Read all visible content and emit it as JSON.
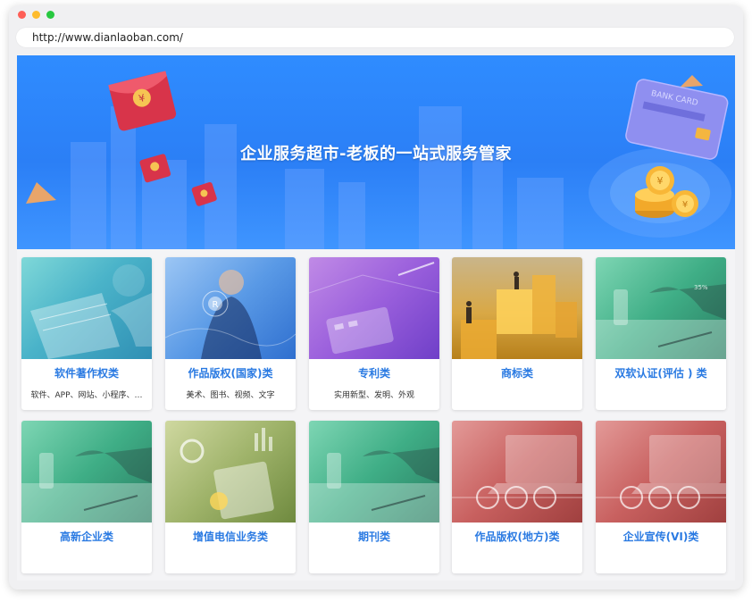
{
  "browser": {
    "url": "http://www.dianlaoban.com/"
  },
  "banner": {
    "title": "企业服务超市-老板的一站式服务管家",
    "card_text": "BANK CARD"
  },
  "cards": [
    {
      "title": "软件著作权类",
      "subtitle": "软件、APP、网站、小程序、…",
      "theme": "teal"
    },
    {
      "title": "作品版权(国家)类",
      "subtitle": "美术、图书、视频、文字",
      "theme": "blue"
    },
    {
      "title": "专利类",
      "subtitle": "实用新型、发明、外观",
      "theme": "purple"
    },
    {
      "title": "商标类",
      "subtitle": "",
      "theme": "gold"
    },
    {
      "title": "双软认证(评估 ) 类",
      "subtitle": "",
      "theme": "green"
    },
    {
      "title": "高新企业类",
      "subtitle": "",
      "theme": "green"
    },
    {
      "title": "增值电信业务类",
      "subtitle": "",
      "theme": "olive"
    },
    {
      "title": "期刊类",
      "subtitle": "",
      "theme": "green"
    },
    {
      "title": "作品版权(地方)类",
      "subtitle": "",
      "theme": "red"
    },
    {
      "title": "企业宣传(VI)类",
      "subtitle": "",
      "theme": "red"
    }
  ],
  "colors": {
    "accent": "#2a7ae2",
    "banner": "#2f8cff"
  }
}
